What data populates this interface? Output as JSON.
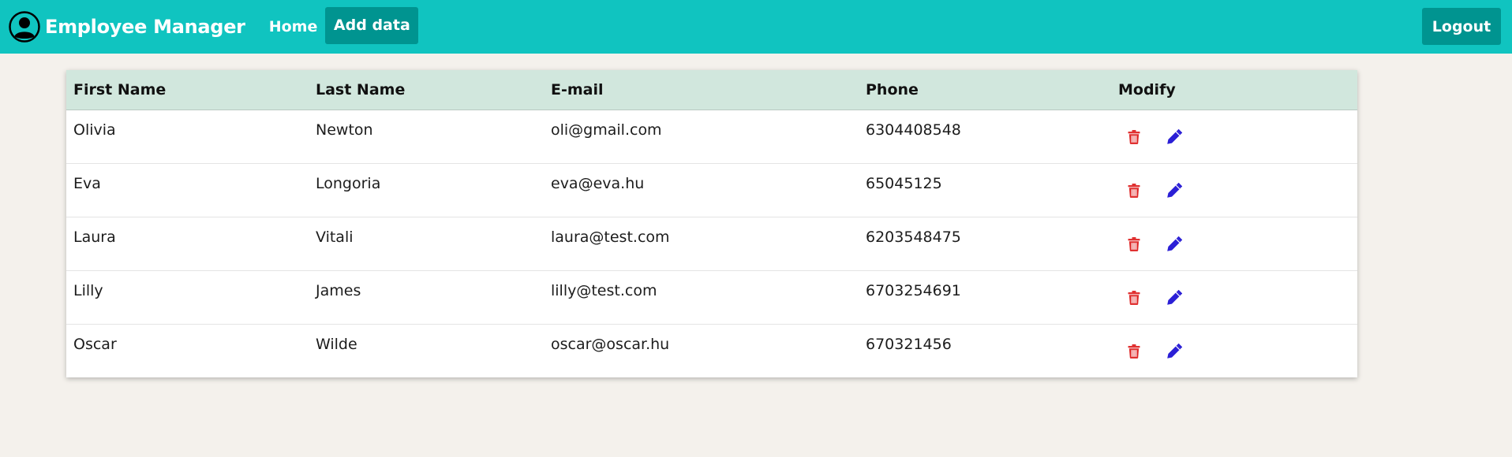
{
  "navbar": {
    "brand_title": "Employee Manager",
    "brand_icon": "user-circle-icon",
    "home_label": "Home",
    "add_label": "Add data",
    "logout_label": "Logout",
    "bg_color": "#10c4c0",
    "active_bg_color": "#009490"
  },
  "table": {
    "headers": [
      "First Name",
      "Last Name",
      "E-mail",
      "Phone",
      "Modify"
    ],
    "rows": [
      {
        "first": "Olivia",
        "last": "Newton",
        "email": "oli@gmail.com",
        "phone": "6304408548"
      },
      {
        "first": "Eva",
        "last": "Longoria",
        "email": "eva@eva.hu",
        "phone": "65045125"
      },
      {
        "first": "Laura",
        "last": "Vitali",
        "email": "laura@test.com",
        "phone": "6203548475"
      },
      {
        "first": "Lilly",
        "last": "James",
        "email": "lilly@test.com",
        "phone": "6703254691"
      },
      {
        "first": "Oscar",
        "last": "Wilde",
        "email": "oscar@oscar.hu",
        "phone": "670321456"
      }
    ],
    "header_bg": "#d1e7dd",
    "delete_icon": "trash-icon",
    "delete_color": "#e03131",
    "edit_icon": "pencil-icon",
    "edit_color": "#2b1fd6"
  }
}
